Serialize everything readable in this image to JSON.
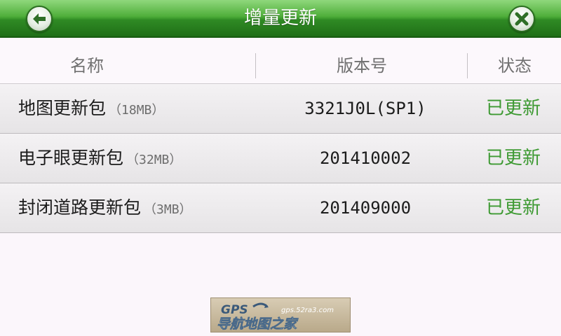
{
  "header": {
    "title": "增量更新",
    "back_icon": "back-arrow-icon",
    "close_icon": "close-x-icon"
  },
  "columns": {
    "name": "名称",
    "version": "版本号",
    "status": "状态"
  },
  "rows": [
    {
      "name": "地图更新包",
      "size": "（18MB）",
      "version": "3321J0L(SP1)",
      "status": "已更新"
    },
    {
      "name": "电子眼更新包",
      "size": "（32MB）",
      "version": "201410002",
      "status": "已更新"
    },
    {
      "name": "封闭道路更新包",
      "size": "（3MB）",
      "version": "201409000",
      "status": "已更新"
    }
  ],
  "watermark": {
    "brand": "GPS",
    "site": "gps.52ra3.com",
    "tagline": "导航地图之家"
  },
  "colors": {
    "header_green": "#3a9a2c",
    "status_green": "#3e9a33",
    "background": "#fbf6fb"
  }
}
